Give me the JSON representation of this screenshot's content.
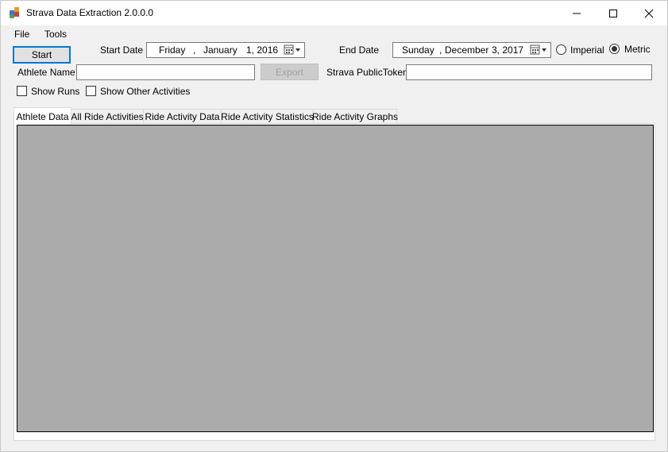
{
  "window": {
    "title": "Strava Data Extraction 2.0.0.0"
  },
  "menu": {
    "items": [
      "File",
      "Tools"
    ]
  },
  "controls": {
    "start_label": "Start",
    "start_date_label": "Start Date",
    "start_date": {
      "day": "Friday",
      "sep": ",",
      "month": "January",
      "date": "1, 2016"
    },
    "end_date_label": "End Date",
    "end_date": {
      "day": "Sunday",
      "sep": ",",
      "month": "December",
      "date": "3, 2017"
    },
    "units": {
      "imperial": "Imperial",
      "metric": "Metric",
      "selected": "Metric"
    },
    "athlete_name_label": "Athlete Name",
    "athlete_name_value": "",
    "export_label": "Export",
    "token_label": "Strava PublicToken",
    "token_value": "",
    "show_runs_label": "Show Runs",
    "show_other_label": "Show Other Activities"
  },
  "tabs": [
    {
      "label": "Athlete Data",
      "active": true
    },
    {
      "label": "All Ride Activities",
      "active": false
    },
    {
      "label": "Ride Activity Data",
      "active": false
    },
    {
      "label": "Ride Activity Statistics",
      "active": false
    },
    {
      "label": "Ride Activity Graphs",
      "active": false
    }
  ],
  "colors": {
    "grid_background": "#ababab",
    "focus_border": "#0078d7"
  }
}
